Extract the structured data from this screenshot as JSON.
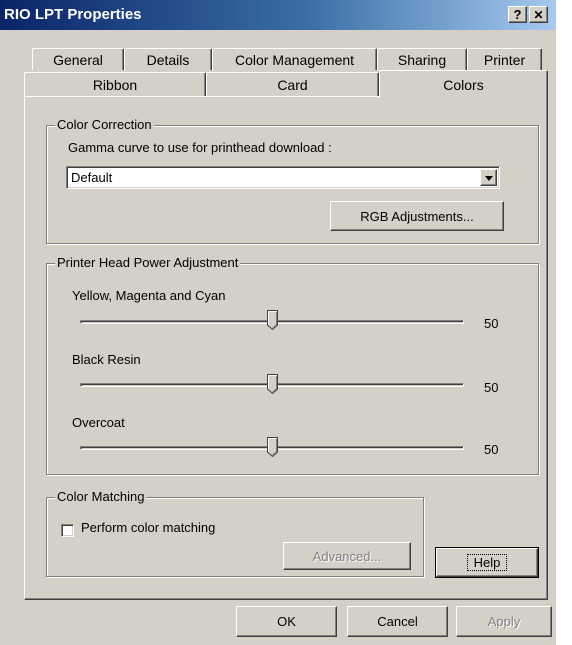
{
  "window": {
    "title": "RIO LPT Properties",
    "help_glyph": "?",
    "close_glyph": "✕"
  },
  "tabs": {
    "row1": [
      {
        "label": "General"
      },
      {
        "label": "Details"
      },
      {
        "label": "Color Management"
      },
      {
        "label": "Sharing"
      },
      {
        "label": "Printer"
      }
    ],
    "row2": [
      {
        "label": "Ribbon"
      },
      {
        "label": "Card"
      },
      {
        "label": "Colors",
        "active": true
      }
    ]
  },
  "color_correction": {
    "group_label": "Color Correction",
    "gamma_label": "Gamma curve to use for printhead download :",
    "gamma_selected": "Default",
    "rgb_button": "RGB Adjustments..."
  },
  "power_adjustment": {
    "group_label": "Printer Head Power Adjustment",
    "sliders": [
      {
        "label": "Yellow, Magenta and Cyan",
        "value": "50",
        "level": 0.5
      },
      {
        "label": "Black Resin",
        "value": "50",
        "level": 0.5
      },
      {
        "label": "Overcoat",
        "value": "50",
        "level": 0.5
      }
    ]
  },
  "color_matching": {
    "group_label": "Color Matching",
    "checkbox_label": "Perform color matching",
    "checked": false,
    "advanced_button": "Advanced..."
  },
  "buttons": {
    "help": "Help",
    "ok": "OK",
    "cancel": "Cancel",
    "apply": "Apply"
  }
}
